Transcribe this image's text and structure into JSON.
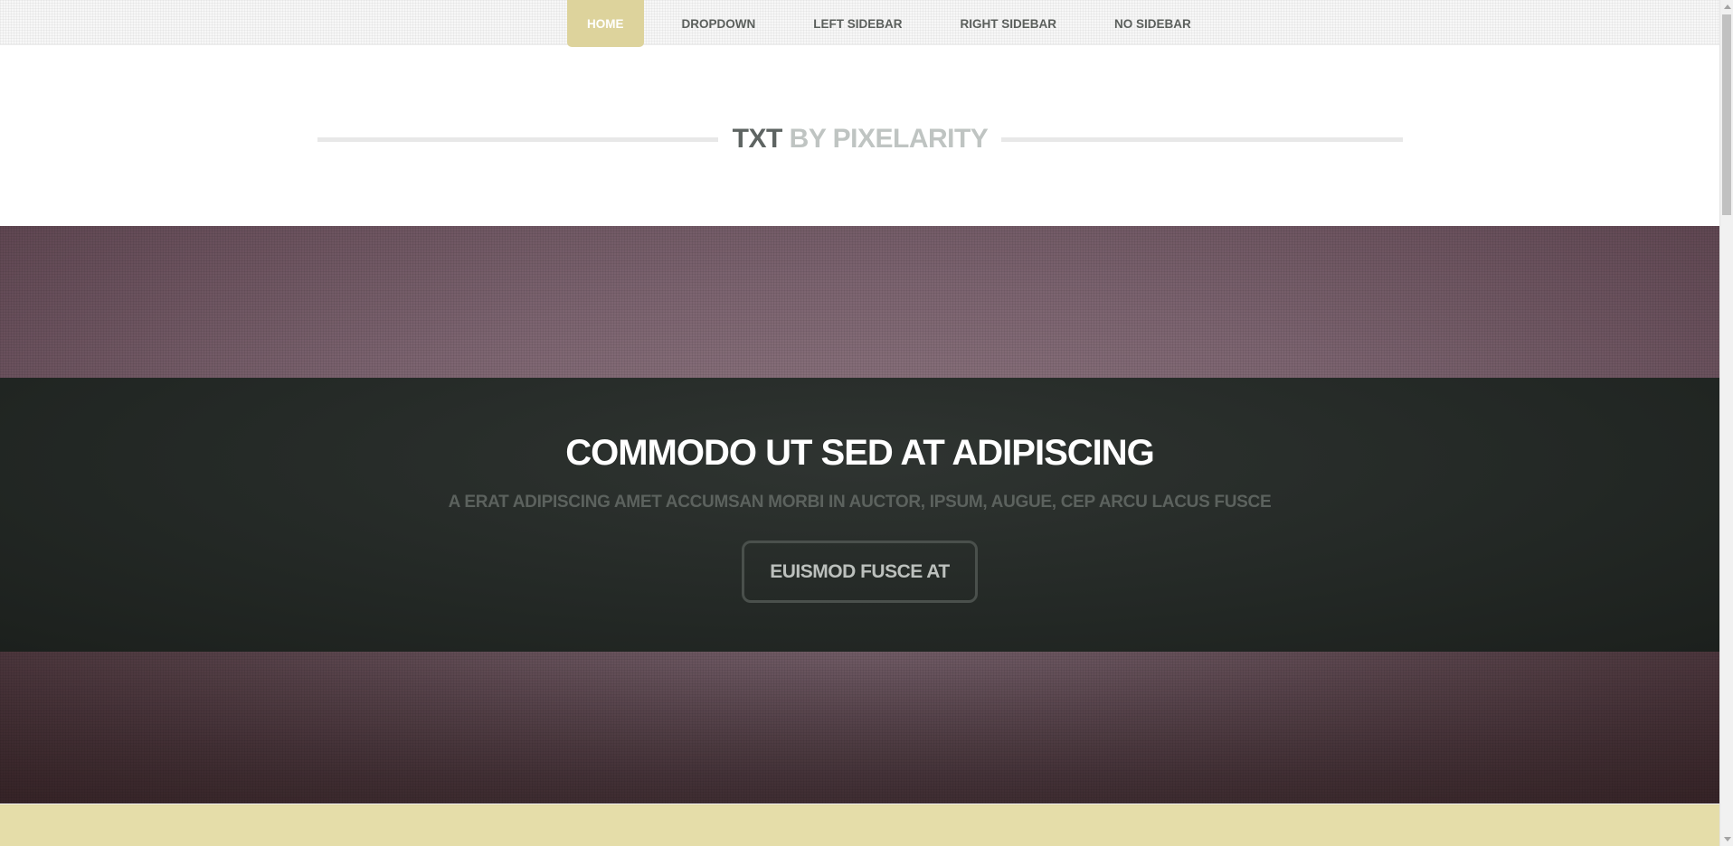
{
  "nav": {
    "items": [
      {
        "label": "HOME",
        "active": true
      },
      {
        "label": "DROPDOWN",
        "active": false
      },
      {
        "label": "LEFT SIDEBAR",
        "active": false
      },
      {
        "label": "RIGHT SIDEBAR",
        "active": false
      },
      {
        "label": "NO SIDEBAR",
        "active": false
      }
    ]
  },
  "logo": {
    "strong": "TXT",
    "light": " BY PIXELARITY"
  },
  "banner": {
    "title": "COMMODO UT SED AT ADIPISCING",
    "subtitle": "A ERAT ADIPISCING AMET ACCUMSAN MORBI IN AUCTOR, IPSUM, AUGUE, CEP ARCU LACUS FUSCE",
    "button_label": "EUISMOD FUSCE AT"
  },
  "colors": {
    "accent": "#ddd39c",
    "bottom_strip": "#e5dda9",
    "banner_dark": "#242926",
    "banner_mauve": "#7c6470"
  },
  "icons": {
    "scroll_up": "triangle-up-icon",
    "scroll_down": "triangle-down-icon"
  }
}
